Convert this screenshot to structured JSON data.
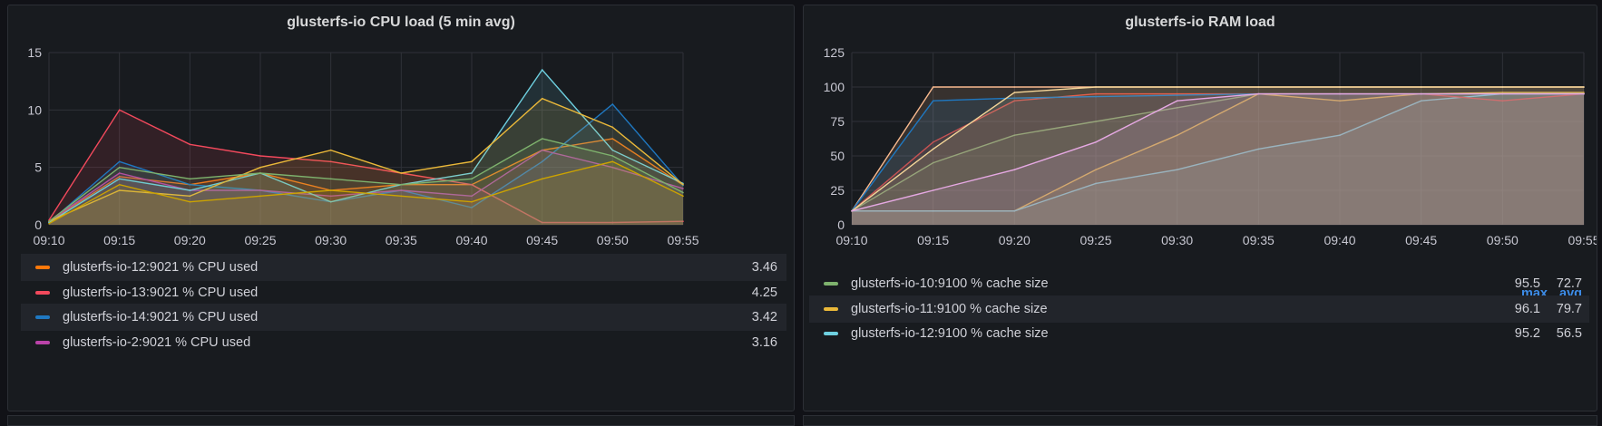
{
  "panels": {
    "cpu": {
      "title": "glusterfs-io CPU load (5 min avg)",
      "legend": [
        {
          "name": "glusterfs-io-12:9021 % CPU used",
          "value": "3.46",
          "color": "#ff780a"
        },
        {
          "name": "glusterfs-io-13:9021 % CPU used",
          "value": "4.25",
          "color": "#f2495c"
        },
        {
          "name": "glusterfs-io-14:9021 % CPU used",
          "value": "3.42",
          "color": "#1f78c1"
        },
        {
          "name": "glusterfs-io-2:9021 % CPU used",
          "value": "3.16",
          "color": "#ba43a9"
        }
      ]
    },
    "ram": {
      "title": "glusterfs-io RAM load",
      "legend_headers": {
        "max": "max",
        "avg": "avg"
      },
      "legend": [
        {
          "name": "glusterfs-io-10:9100 % cache size",
          "max": "95.5",
          "avg": "72.7",
          "color": "#7eb26d"
        },
        {
          "name": "glusterfs-io-11:9100 % cache size",
          "max": "96.1",
          "avg": "79.7",
          "color": "#eab839"
        },
        {
          "name": "glusterfs-io-12:9100 % cache size",
          "max": "95.2",
          "avg": "56.5",
          "color": "#6ed0e0"
        }
      ]
    }
  },
  "chart_data": [
    {
      "type": "line",
      "title": "glusterfs-io CPU load (5 min avg)",
      "x": [
        "09:10",
        "09:15",
        "09:20",
        "09:25",
        "09:30",
        "09:35",
        "09:40",
        "09:45",
        "09:50",
        "09:55"
      ],
      "yticks": [
        0,
        5,
        10,
        15
      ],
      "ylim": [
        0,
        15
      ],
      "grid": true,
      "legend_position": "bottom",
      "series": [
        {
          "name": "glusterfs-io-12:9021 % CPU used",
          "color": "#ff780a",
          "values": [
            0.3,
            4.2,
            3.5,
            4.5,
            3.0,
            3.5,
            3.5,
            6.5,
            7.5,
            3.46
          ]
        },
        {
          "name": "glusterfs-io-13:9021 % CPU used",
          "color": "#f2495c",
          "values": [
            0.4,
            10.0,
            7.0,
            6.0,
            5.5,
            4.5,
            3.5,
            0.2,
            0.2,
            0.3
          ]
        },
        {
          "name": "glusterfs-io-14:9021 % CPU used",
          "color": "#1f78c1",
          "values": [
            0.2,
            5.5,
            3.5,
            3.0,
            2.0,
            3.0,
            1.5,
            5.5,
            10.5,
            3.42
          ]
        },
        {
          "name": "glusterfs-io-2:9021 % CPU used",
          "color": "#ba43a9",
          "values": [
            0.3,
            4.5,
            3.0,
            3.0,
            2.5,
            3.0,
            2.5,
            6.5,
            5.0,
            3.16
          ]
        },
        {
          "color": "#6ed0e0",
          "values": [
            0.2,
            4.0,
            3.0,
            4.5,
            2.0,
            3.5,
            4.5,
            13.5,
            6.5,
            3.6
          ]
        },
        {
          "color": "#eab839",
          "values": [
            0.3,
            3.0,
            2.5,
            5.0,
            6.5,
            4.5,
            5.5,
            11.0,
            8.5,
            3.5
          ]
        },
        {
          "color": "#7eb26d",
          "values": [
            0.3,
            5.0,
            4.0,
            4.5,
            4.0,
            3.5,
            4.0,
            7.5,
            6.0,
            2.8
          ]
        },
        {
          "color": "#cca300",
          "values": [
            0.1,
            3.5,
            2.0,
            2.5,
            3.0,
            2.5,
            2.0,
            4.0,
            5.5,
            2.5
          ]
        }
      ]
    },
    {
      "type": "area",
      "title": "glusterfs-io RAM load",
      "x": [
        "09:10",
        "09:15",
        "09:20",
        "09:25",
        "09:30",
        "09:35",
        "09:40",
        "09:45",
        "09:50",
        "09:55"
      ],
      "yticks": [
        0,
        25,
        50,
        75,
        100,
        125
      ],
      "ylim": [
        0,
        125
      ],
      "grid": true,
      "legend_position": "bottom",
      "series": [
        {
          "name": "glusterfs-io-10:9100 % cache size",
          "color": "#7eb26d",
          "values": [
            10,
            45,
            65,
            75,
            85,
            95,
            95,
            95,
            95,
            95
          ]
        },
        {
          "name": "glusterfs-io-11:9100 % cache size",
          "color": "#eab839",
          "values": [
            10,
            10,
            10,
            40,
            65,
            95,
            90,
            95,
            96,
            96
          ]
        },
        {
          "name": "glusterfs-io-12:9100 % cache size",
          "color": "#6ed0e0",
          "values": [
            10,
            10,
            10,
            30,
            40,
            55,
            65,
            90,
            95,
            95
          ]
        },
        {
          "color": "#f9ba8f",
          "values": [
            10,
            100,
            100,
            100,
            100,
            100,
            100,
            100,
            100,
            100
          ]
        },
        {
          "color": "#e24d42",
          "values": [
            10,
            60,
            90,
            95,
            95,
            95,
            95,
            95,
            90,
            95
          ]
        },
        {
          "color": "#1f78c1",
          "values": [
            10,
            90,
            92,
            93,
            94,
            95,
            95,
            95,
            95,
            95
          ]
        },
        {
          "color": "#f4d598",
          "values": [
            10,
            55,
            96,
            100,
            100,
            100,
            100,
            100,
            100,
            100
          ]
        },
        {
          "color": "#e5a8e2",
          "values": [
            10,
            25,
            40,
            60,
            90,
            95,
            95,
            95,
            95,
            95
          ]
        }
      ]
    }
  ]
}
